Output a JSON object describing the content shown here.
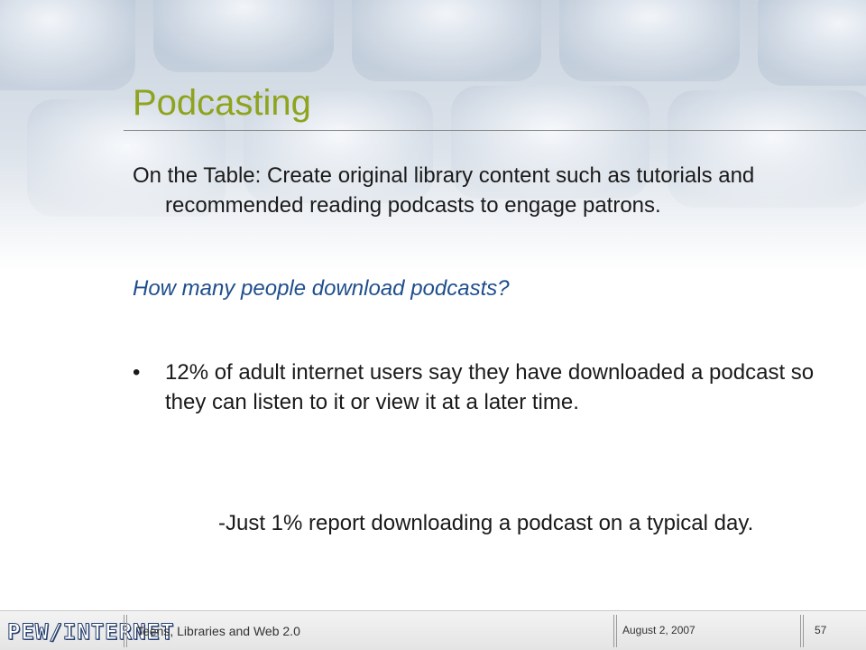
{
  "slide": {
    "title": "Podcasting",
    "intro": "On the Table: Create original library content such as tutorials and recommended reading podcasts to engage patrons.",
    "question": "How many people download podcasts?",
    "bullet_char": "•",
    "bullet": "12% of adult internet users say they have downloaded a podcast so they can listen to it or view it at a later time.",
    "sub_point": "-Just 1% report downloading a podcast on a typical day."
  },
  "footer": {
    "logo": "PEW/INTERNET",
    "left_text": "Teens, Libraries and Web 2.0",
    "date": "August 2, 2007",
    "page_number": "57"
  },
  "colors": {
    "title": "#8ea31e",
    "question": "#1f4e8c",
    "logo_stroke": "#27406f"
  }
}
